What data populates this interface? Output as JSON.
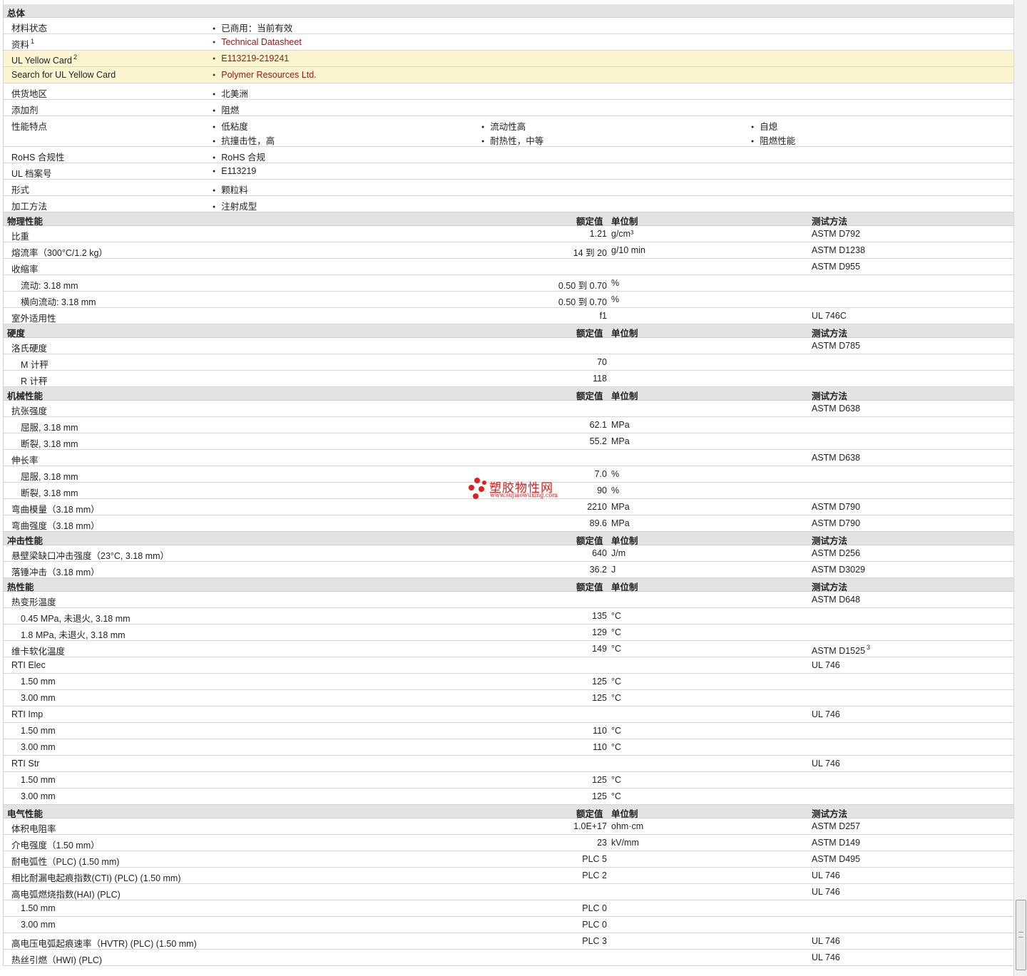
{
  "header_labels": {
    "value": "额定值",
    "unit": "单位制",
    "test": "测试方法"
  },
  "general": {
    "title": "总体",
    "rows": [
      {
        "label": "材料状态",
        "items": [
          "已商用：当前有效"
        ]
      },
      {
        "label": "资料",
        "sup": "1",
        "items": [
          "Technical Datasheet"
        ],
        "link": true
      },
      {
        "label": "UL Yellow Card",
        "sup": "2",
        "items": [
          "E113219-219241"
        ],
        "link": true,
        "highlight": true
      },
      {
        "label": "Search for UL Yellow Card",
        "items": [
          "Polymer Resources Ltd."
        ],
        "link": true,
        "highlight": true
      },
      {
        "label": "供货地区",
        "items": [
          "北美洲"
        ]
      },
      {
        "label": "添加剂",
        "items": [
          "阻燃"
        ]
      },
      {
        "label": "性能特点",
        "grid": [
          [
            "低粘度",
            "流动性高",
            "自熄"
          ],
          [
            "抗撞击性，高",
            "耐热性，中等",
            "阻燃性能"
          ]
        ]
      },
      {
        "label": "RoHS 合规性",
        "items": [
          "RoHS 合规"
        ]
      },
      {
        "label": "UL 档案号",
        "items": [
          "E113219"
        ]
      },
      {
        "label": "形式",
        "items": [
          "颗粒料"
        ]
      },
      {
        "label": "加工方法",
        "items": [
          "注射成型"
        ]
      }
    ]
  },
  "sections": [
    {
      "title": "物理性能",
      "rows": [
        {
          "label": "比重",
          "value": "1.21",
          "unit": "g/cm³",
          "test": "ASTM D792"
        },
        {
          "label": "熔流率（300°C/1.2 kg）",
          "value": "14 到  20",
          "unit": "g/10 min",
          "test": "ASTM D1238"
        },
        {
          "label": "收缩率",
          "test": "ASTM D955"
        },
        {
          "label": "流动: 3.18 mm",
          "sub": true,
          "value": "0.50 到  0.70",
          "unit": "%"
        },
        {
          "label": "横向流动: 3.18 mm",
          "sub": true,
          "value": "0.50 到  0.70",
          "unit": "%"
        },
        {
          "label": "室外适用性",
          "value": "f1",
          "test": "UL 746C"
        }
      ]
    },
    {
      "title": "硬度",
      "rows": [
        {
          "label": "洛氏硬度",
          "test": "ASTM D785"
        },
        {
          "label": "M 计秤",
          "sub": true,
          "value": "70"
        },
        {
          "label": "R 计秤",
          "sub": true,
          "value": "118"
        }
      ]
    },
    {
      "title": "机械性能",
      "rows": [
        {
          "label": "抗张强度",
          "test": "ASTM D638"
        },
        {
          "label": "屈服, 3.18 mm",
          "sub": true,
          "value": "62.1",
          "unit": "MPa"
        },
        {
          "label": "断裂, 3.18 mm",
          "sub": true,
          "value": "55.2",
          "unit": "MPa"
        },
        {
          "label": "伸长率",
          "test": "ASTM D638"
        },
        {
          "label": "屈服, 3.18 mm",
          "sub": true,
          "value": "7.0",
          "unit": "%"
        },
        {
          "label": "断裂, 3.18 mm",
          "sub": true,
          "value": "90",
          "unit": "%"
        },
        {
          "label": "弯曲模量（3.18 mm）",
          "value": "2210",
          "unit": "MPa",
          "test": "ASTM D790"
        },
        {
          "label": "弯曲强度（3.18 mm）",
          "value": "89.6",
          "unit": "MPa",
          "test": "ASTM D790"
        }
      ]
    },
    {
      "title": "冲击性能",
      "rows": [
        {
          "label": "悬壁梁缺口冲击强度（23°C, 3.18 mm）",
          "value": "640",
          "unit": "J/m",
          "test": "ASTM D256"
        },
        {
          "label": "落锤冲击（3.18 mm）",
          "value": "36.2",
          "unit": "J",
          "test": "ASTM D3029"
        }
      ]
    },
    {
      "title": "热性能",
      "rows": [
        {
          "label": "热变形温度",
          "test": "ASTM D648"
        },
        {
          "label": "0.45 MPa, 未退火, 3.18 mm",
          "sub": true,
          "value": "135",
          "unit": "°C"
        },
        {
          "label": "1.8 MPa, 未退火, 3.18 mm",
          "sub": true,
          "value": "129",
          "unit": "°C"
        },
        {
          "label": "维卡软化温度",
          "value": "149",
          "unit": "°C",
          "test": "ASTM D1525",
          "test_sup": "3"
        },
        {
          "label": "RTI Elec",
          "test": "UL 746"
        },
        {
          "label": "1.50 mm",
          "sub": true,
          "value": "125",
          "unit": "°C"
        },
        {
          "label": "3.00 mm",
          "sub": true,
          "value": "125",
          "unit": "°C"
        },
        {
          "label": "RTI Imp",
          "test": "UL 746"
        },
        {
          "label": "1.50 mm",
          "sub": true,
          "value": "110",
          "unit": "°C"
        },
        {
          "label": "3.00 mm",
          "sub": true,
          "value": "110",
          "unit": "°C"
        },
        {
          "label": "RTI Str",
          "test": "UL 746"
        },
        {
          "label": "1.50 mm",
          "sub": true,
          "value": "125",
          "unit": "°C"
        },
        {
          "label": "3.00 mm",
          "sub": true,
          "value": "125",
          "unit": "°C"
        }
      ]
    },
    {
      "title": "电气性能",
      "rows": [
        {
          "label": "体积电阻率",
          "value": "1.0E+17",
          "unit": "ohm·cm",
          "test": "ASTM D257"
        },
        {
          "label": "介电强度（1.50 mm）",
          "value": "23",
          "unit": "kV/mm",
          "test": "ASTM D149"
        },
        {
          "label": "耐电弧性（PLC) (1.50 mm)",
          "value": "PLC 5",
          "test": "ASTM D495"
        },
        {
          "label": "相比耐漏电起痕指数(CTI) (PLC) (1.50 mm)",
          "value": "PLC 2",
          "test": "UL 746"
        },
        {
          "label": "高电弧燃烧指数(HAI) (PLC)",
          "test": "UL 746"
        },
        {
          "label": "1.50 mm",
          "sub": true,
          "value": "PLC 0"
        },
        {
          "label": "3.00 mm",
          "sub": true,
          "value": "PLC 0"
        },
        {
          "label": "高电压电弧起痕速率（HVTR) (PLC) (1.50 mm)",
          "value": "PLC 3",
          "test": "UL 746"
        },
        {
          "label": "热丝引燃（HWI) (PLC)",
          "test": "UL 746"
        }
      ]
    }
  ],
  "watermark": {
    "name": "塑胶物性网",
    "url": "www.sujiaowuxing.com"
  }
}
